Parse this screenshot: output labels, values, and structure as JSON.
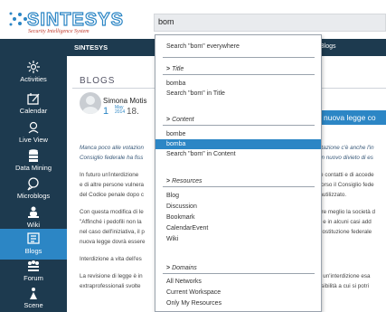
{
  "app": {
    "logo_text": "SINTESYS",
    "logo_tagline": "Security Intelligence System"
  },
  "search": {
    "value": "bom"
  },
  "topbar": {
    "title": "SINTESYS",
    "right_label": "Blogs"
  },
  "sidebar": {
    "items": [
      {
        "label": "Activities",
        "icon": "activities-icon"
      },
      {
        "label": "Calendar",
        "icon": "calendar-icon"
      },
      {
        "label": "Live View",
        "icon": "live-view-icon"
      },
      {
        "label": "Data Mining",
        "icon": "data-mining-icon"
      },
      {
        "label": "Microblogs",
        "icon": "microblogs-icon"
      },
      {
        "label": "Wiki",
        "icon": "wiki-icon"
      },
      {
        "label": "Blogs",
        "icon": "blogs-icon",
        "active": true
      },
      {
        "label": "Forum",
        "icon": "forum-icon"
      },
      {
        "label": "Scene",
        "icon": "scene-icon"
      }
    ],
    "active_color": "#2c86c5",
    "background": "#1d3a4f"
  },
  "main": {
    "heading": "BLOGS",
    "author": "Simona Motis",
    "date_day": "1",
    "date_month": "May",
    "date_year": "2014",
    "date_day2": "18.",
    "headline": "nuova legge co",
    "paragraphs_left": [
      "Manca poco alle votazion",
      "Consiglio federale ha fiss",
      "In futuro un'interdizione",
      "e di altre persone vulnera",
      "del Codice penale dopo c",
      "Con questa modifica di le",
      "\"Affinché i pedofili non la",
      "nel caso dell'iniziativa, il p",
      "nuova legge dovrà essere",
      "Interdizione a vita dell'es",
      "La revisione di legge è in",
      "extraprofessionali svolte"
    ],
    "paragraphs_right": [
      "otazione c'è anche l'in",
      "un nuovo divieto di es",
      "re contatti e di accede",
      "corso il Consiglio fede",
      "inutilizzato.",
      "are meglio la società d",
      "o e in alcuni casi add",
      "Costituzione federale",
      "a un'interdizione esa",
      "ssibilità a cui si potri"
    ]
  },
  "dropdown": {
    "search_everywhere": "Search \"bom\" everywhere",
    "sections": [
      {
        "title": "Title",
        "items": [
          "bomba",
          "Search \"bom\" in Title"
        ]
      },
      {
        "title": "Content",
        "items": [
          "bombe",
          "bomba",
          "Search \"bom\" in Content"
        ],
        "selected_index": 1
      },
      {
        "title": "Resources",
        "items": [
          "Blog",
          "Discussion",
          "Bookmark",
          "CalendarEvent",
          "Wiki"
        ]
      },
      {
        "title": "Domains",
        "items": [
          "All Networks",
          "Current Workspace",
          "Only My Resources"
        ]
      }
    ],
    "selected_color": "#2c86c5"
  }
}
